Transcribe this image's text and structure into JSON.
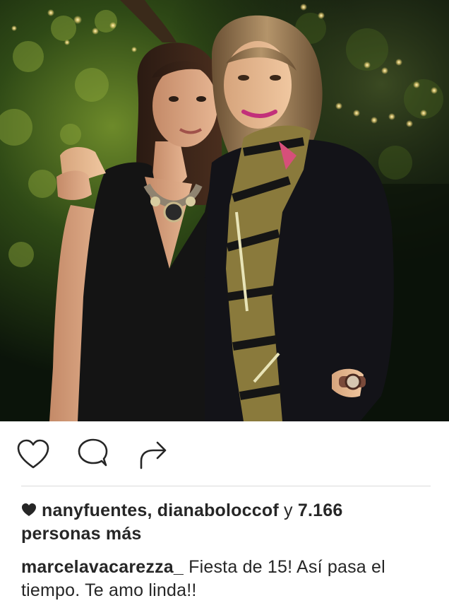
{
  "post": {
    "image": {
      "description": "two-women-night-garden-fairy-lights"
    },
    "actions": {
      "like_icon": "heart-outline-icon",
      "comment_icon": "comment-bubble-icon",
      "share_icon": "share-arrow-icon"
    },
    "likes": {
      "icon": "heart-filled-icon",
      "user1": "nanyfuentes",
      "separator": ",",
      "user2": "dianaboloccof",
      "conjunction": "y",
      "count": "7.166",
      "suffix": "personas más"
    },
    "caption": {
      "username": "marcelavacarezza_",
      "text": "Fiesta de 15! Así pasa el tiempo. Te amo linda!!"
    }
  },
  "colors": {
    "text": "#262626",
    "divider": "#dbdbdb",
    "background": "#ffffff"
  }
}
